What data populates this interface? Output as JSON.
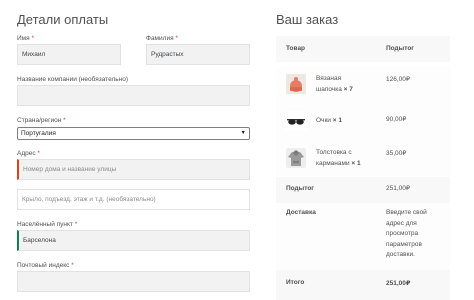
{
  "billing": {
    "title": "Детали оплаты",
    "first_name": {
      "label": "Имя",
      "required": "*",
      "value": "Михаил"
    },
    "last_name": {
      "label": "Фамилия",
      "required": "*",
      "value": "Рудрастых"
    },
    "company": {
      "label": "Название компании (необязательно)",
      "value": ""
    },
    "country": {
      "label": "Страна/регион",
      "required": "*",
      "value": "Португалия"
    },
    "address": {
      "label": "Адрес",
      "required": "*",
      "placeholder_1": "Номер дома и название улицы",
      "placeholder_2": "Крыло, подъезд, этаж и т.д. (необязательно)"
    },
    "city": {
      "label": "Населённый пункт",
      "required": "*",
      "value": "Барселона"
    },
    "postcode": {
      "label": "Почтовый индекс",
      "required": "*",
      "value": ""
    }
  },
  "order": {
    "title": "Ваш заказ",
    "head_product": "Товар",
    "head_subtotal": "Подытог",
    "items": [
      {
        "name_line1": "Вязаная",
        "name_line2": "шапочка",
        "qty": "× 7",
        "price": "126,00₽",
        "icon": "beanie-icon"
      },
      {
        "name_line1": "Очки",
        "name_line2": "",
        "qty": "× 1",
        "price": "90,00₽",
        "icon": "sunglasses-icon"
      },
      {
        "name_line1": "Толстовка с",
        "name_line2": "карманами",
        "qty": "× 1",
        "price": "35,00₽",
        "icon": "hoodie-icon"
      }
    ],
    "subtotal_label": "Подытог",
    "subtotal_value": "251,00₽",
    "shipping_label": "Доставка",
    "shipping_text": [
      "Введите свой",
      "адрес для",
      "просмотра",
      "параметров",
      "доставки."
    ],
    "total_label": "Итого",
    "total_value": "251,00₽"
  },
  "colors": {
    "required": "#e2401c",
    "valid": "#0f834d",
    "field_bg": "#f2f2f2"
  }
}
